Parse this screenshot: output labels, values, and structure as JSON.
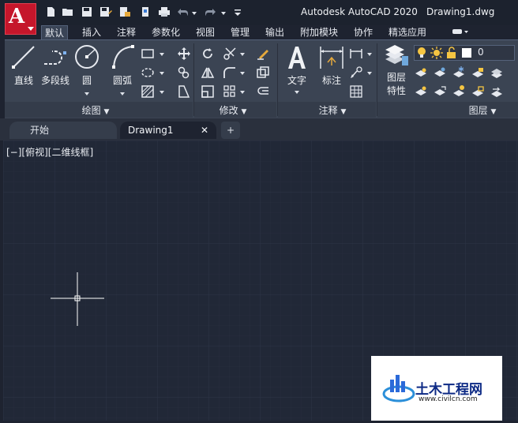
{
  "app": {
    "logo_letter": "A",
    "title": "Autodesk AutoCAD 2020",
    "filename": "Drawing1.dwg",
    "quick_access": [
      "new-icon",
      "open-icon",
      "save-icon",
      "save-as-icon",
      "publish-icon",
      "plot-icon",
      "print-icon",
      "undo-icon",
      "redo-icon",
      "customize-icon"
    ]
  },
  "ribbon_tabs": [
    "默认",
    "插入",
    "注释",
    "参数化",
    "视图",
    "管理",
    "输出",
    "附加模块",
    "协作",
    "精选应用"
  ],
  "active_tab": "默认",
  "panels": {
    "draw": {
      "title": "绘图",
      "tools": [
        "直线",
        "多段线",
        "圆",
        "圆弧"
      ]
    },
    "modify": {
      "title": "修改"
    },
    "annotation": {
      "title": "注释",
      "tools": [
        "文字",
        "标注"
      ]
    },
    "layers": {
      "title": "图层",
      "properties_label_1": "图层",
      "properties_label_2": "特性",
      "current_layer": "0"
    }
  },
  "document_tabs": {
    "start": "开始",
    "active": "Drawing1",
    "close": "✕",
    "add": "+"
  },
  "viewport_label": "[−][俯视][二维线框]",
  "watermark": {
    "name": "土木工程网",
    "url": "www.civilcn.com"
  },
  "colors": {
    "accent": "#c5162b",
    "ribbon_bg": "#3b4453",
    "canvas_bg": "#212837",
    "grid": "#2b3345"
  }
}
